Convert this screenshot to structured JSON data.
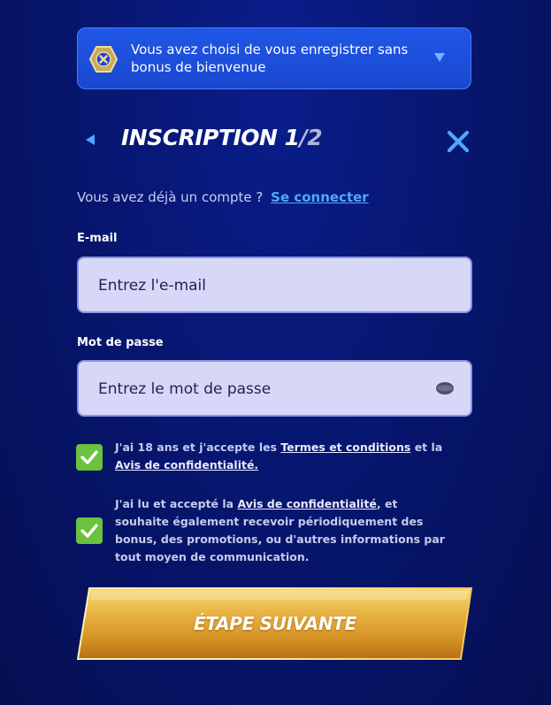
{
  "banner": {
    "text": "Vous avez choisi de vous enregistrer sans bonus de bienvenue",
    "icon": "no-bonus-icon"
  },
  "header": {
    "title_main": "INSCRIPTION 1",
    "title_sep": "/",
    "title_total": "2"
  },
  "account": {
    "question": "Vous avez déjà un compte ?",
    "login_link": "Se connecter"
  },
  "form": {
    "email_label": "E-mail",
    "email_placeholder": "Entrez l'e-mail",
    "email_value": "",
    "password_label": "Mot de passe",
    "password_placeholder": "Entrez le mot de passe",
    "password_value": ""
  },
  "consents": [
    {
      "checked": true,
      "text_1": "J'ai 18 ans et j'accepte les",
      "link_1": "Termes et conditions",
      "text_2": "et la",
      "link_2": "Avis de confidentialité."
    },
    {
      "checked": true,
      "text_1": "J'ai lu et accepté la",
      "link_1": "Avis de confidentialité",
      "text_2": ", et souhaite également recevoir périodiquement des bonus, des promotions, ou d'autres informations par tout moyen de communication."
    }
  ],
  "next_button": {
    "label": "ÉTAPE SUIVANTE"
  },
  "colors": {
    "background": "#071670",
    "banner": "#1a47d0",
    "link": "#4fa8ff",
    "field_bg": "#d7d8f7",
    "checkbox": "#6ac23e",
    "button_gold": "#e0a52a"
  }
}
